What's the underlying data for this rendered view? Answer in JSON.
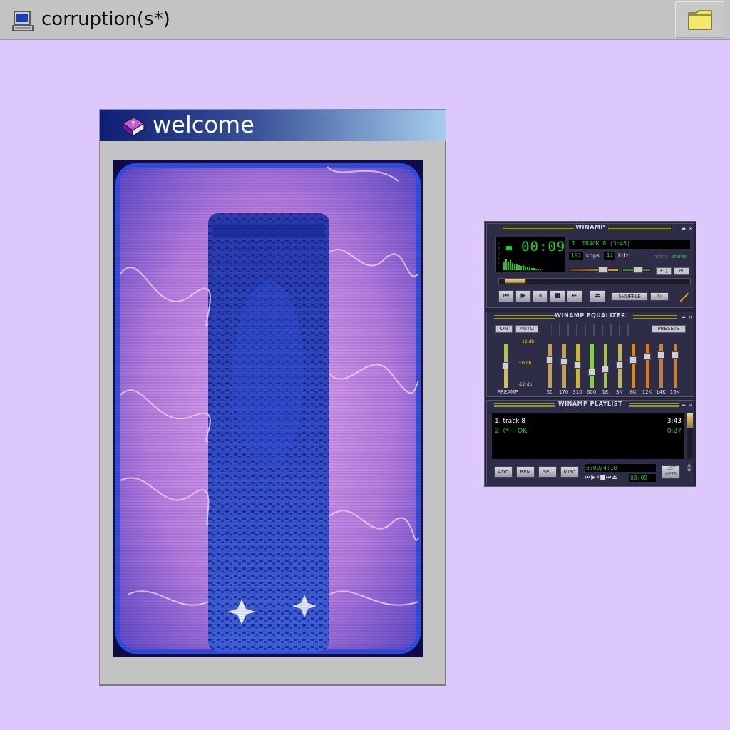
{
  "topbar": {
    "title": "corruption(s*)",
    "icons": {
      "app": "computer-icon",
      "folder": "folder-icon"
    }
  },
  "welcome": {
    "title": "welcome",
    "icon": "help-book-icon"
  },
  "winamp": {
    "main": {
      "title": "WINAMP",
      "time": "00:09",
      "ticker": "1. TRACK 8 (3:43)",
      "kbps_value": "192",
      "kbps_label": "kbps",
      "khz_value": "44",
      "khz_label": "kHz",
      "mono": "mono",
      "stereo": "stereo",
      "eq_btn": "EQ",
      "pl_btn": "PL",
      "shuffle": "SHUFFLE",
      "volume_level": 0.6,
      "balance_level": 0.5,
      "seek_position": 0.04
    },
    "eq": {
      "title": "WINAMP EQUALIZER",
      "on": "ON",
      "auto": "AUTO",
      "presets": "PRESETS",
      "db_high": "+12 db",
      "db_mid": "+0 db",
      "db_low": "-12 db",
      "preamp": "PREAMP",
      "bands": [
        {
          "label": "60",
          "level": 0.35
        },
        {
          "label": "170",
          "level": 0.38
        },
        {
          "label": "310",
          "level": 0.48
        },
        {
          "label": "600",
          "level": 0.68
        },
        {
          "label": "1K",
          "level": 0.6
        },
        {
          "label": "3K",
          "level": 0.48
        },
        {
          "label": "6K",
          "level": 0.35
        },
        {
          "label": "12K",
          "level": 0.25
        },
        {
          "label": "14K",
          "level": 0.22
        },
        {
          "label": "16K",
          "level": 0.22
        }
      ],
      "preamp_level": 0.5
    },
    "playlist": {
      "title": "WINAMP PLAYLIST",
      "tracks": [
        {
          "name": "1. track 8",
          "time": "3:43"
        },
        {
          "name": "2. (*) - OK",
          "time": "0:27"
        }
      ],
      "buttons": [
        "ADD",
        "REM",
        "SEL",
        "MISC"
      ],
      "total": "0:00/4:10",
      "mini_time": "00:09",
      "list_opts": "LIST OPTS"
    }
  },
  "colors": {
    "desktop": "#dcc8fb",
    "lcd_green": "#19d119",
    "title_gradient_start": "#0d1f73",
    "title_gradient_end": "#a6cdee"
  }
}
